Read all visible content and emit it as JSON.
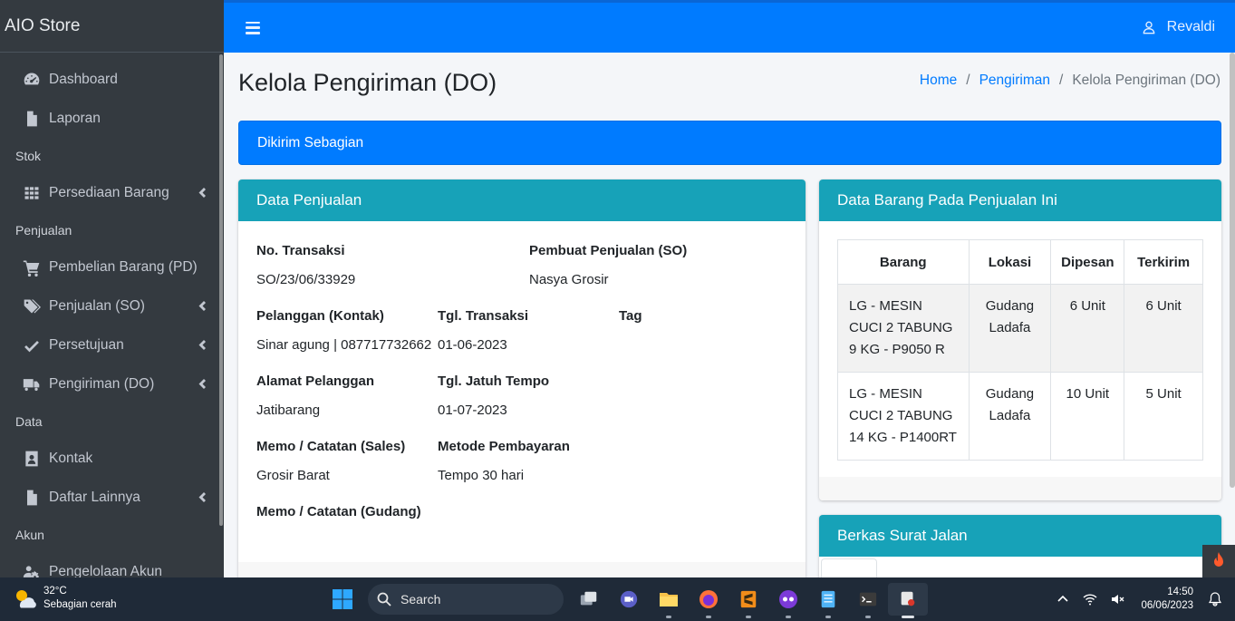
{
  "brand": "AIO Store",
  "sidebar": {
    "items": [
      {
        "label": "Dashboard",
        "icon": "tachometer-icon"
      },
      {
        "label": "Laporan",
        "icon": "document-icon"
      },
      {
        "header": "Stok"
      },
      {
        "label": "Persediaan Barang",
        "icon": "grid-icon",
        "chevron": true
      },
      {
        "header": "Penjualan"
      },
      {
        "label": "Pembelian Barang (PD)",
        "icon": "cart-icon"
      },
      {
        "label": "Penjualan (SO)",
        "icon": "tags-icon",
        "chevron": true
      },
      {
        "label": "Persetujuan",
        "icon": "check-icon",
        "chevron": true
      },
      {
        "label": "Pengiriman (DO)",
        "icon": "truck-icon",
        "chevron": true
      },
      {
        "header": "Data"
      },
      {
        "label": "Kontak",
        "icon": "contact-icon"
      },
      {
        "label": "Daftar Lainnya",
        "icon": "file-icon",
        "chevron": true
      },
      {
        "header": "Akun"
      },
      {
        "label": "Pengelolaan Akun",
        "icon": "users-cog-icon"
      }
    ]
  },
  "header": {
    "user_name": "Revaldi"
  },
  "page": {
    "title": "Kelola Pengiriman (DO)",
    "breadcrumb": [
      "Home",
      "Pengiriman",
      "Kelola Pengiriman (DO)"
    ],
    "status": "Dikirim Sebagian"
  },
  "sales": {
    "title": "Data Penjualan",
    "no_transaksi_label": "No. Transaksi",
    "no_transaksi": "SO/23/06/33929",
    "pembuat_label": "Pembuat Penjualan (SO)",
    "pembuat": "Nasya Grosir",
    "pelanggan_label": "Pelanggan (Kontak)",
    "pelanggan": "Sinar agung | 087717732662",
    "tgl_transaksi_label": "Tgl. Transaksi",
    "tgl_transaksi": "01-06-2023",
    "tag_label": "Tag",
    "alamat_label": "Alamat Pelanggan",
    "alamat": "Jatibarang",
    "jatuh_tempo_label": "Tgl. Jatuh Tempo",
    "jatuh_tempo": "01-07-2023",
    "memo_sales_label": "Memo / Catatan (Sales)",
    "memo_sales": "Grosir Barat",
    "metode_label": "Metode Pembayaran",
    "metode": "Tempo 30 hari",
    "memo_gudang_label": "Memo / Catatan (Gudang)"
  },
  "items_card": {
    "title": "Data Barang Pada Penjualan Ini",
    "columns": [
      "Barang",
      "Lokasi",
      "Dipesan",
      "Terkirim"
    ],
    "rows": [
      {
        "barang": "LG - MESIN CUCI 2 TABUNG 9 KG - P9050 R",
        "lokasi": "Gudang Ladafa",
        "dipesan": "6 Unit",
        "terkirim": "6 Unit"
      },
      {
        "barang": "LG - MESIN CUCI 2 TABUNG 14 KG - P1400RT",
        "lokasi": "Gudang Ladafa",
        "dipesan": "10 Unit",
        "terkirim": "5 Unit"
      }
    ]
  },
  "files_card": {
    "title": "Berkas Surat Jalan"
  },
  "taskbar": {
    "weather_temp": "32°C",
    "weather_desc": "Sebagian cerah",
    "search_label": "Search",
    "time": "14:50",
    "date": "06/06/2023"
  },
  "colors": {
    "primary": "#007bff",
    "info": "#17a2b8",
    "sidebar": "#343a40"
  }
}
